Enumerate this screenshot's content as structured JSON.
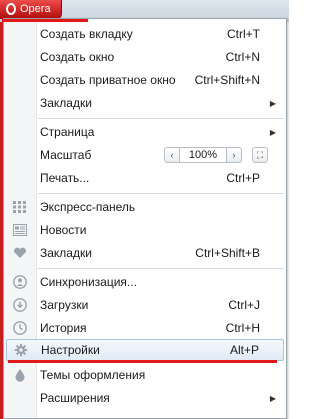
{
  "browser": {
    "menu_button_label": "Opera",
    "accent": "#e01818"
  },
  "menu": {
    "new_tab": {
      "label": "Создать вкладку",
      "shortcut": "Ctrl+T"
    },
    "new_window": {
      "label": "Создать окно",
      "shortcut": "Ctrl+N"
    },
    "new_private_window": {
      "label": "Создать приватное окно",
      "shortcut": "Ctrl+Shift+N"
    },
    "bookmarks_submenu": {
      "label": "Закладки"
    },
    "page": {
      "label": "Страница"
    },
    "zoom": {
      "label": "Масштаб",
      "value": "100%",
      "minus": "‹",
      "plus": "›",
      "fit": "⛶"
    },
    "print": {
      "label": "Печать...",
      "shortcut": "Ctrl+P"
    },
    "speed_dial": {
      "label": "Экспресс-панель",
      "icon": "grid-icon"
    },
    "news": {
      "label": "Новости",
      "icon": "news-icon"
    },
    "bookmarks": {
      "label": "Закладки",
      "shortcut": "Ctrl+Shift+B",
      "icon": "heart-icon"
    },
    "sync": {
      "label": "Синхронизация...",
      "icon": "user-icon"
    },
    "downloads": {
      "label": "Загрузки",
      "shortcut": "Ctrl+J",
      "icon": "download-icon"
    },
    "history": {
      "label": "История",
      "shortcut": "Ctrl+H",
      "icon": "clock-icon"
    },
    "settings": {
      "label": "Настройки",
      "shortcut": "Alt+P",
      "icon": "gear-icon"
    },
    "themes": {
      "label": "Темы оформления",
      "icon": "drop-icon"
    },
    "extensions": {
      "label": "Расширения",
      "icon": "puzzle-icon"
    }
  }
}
